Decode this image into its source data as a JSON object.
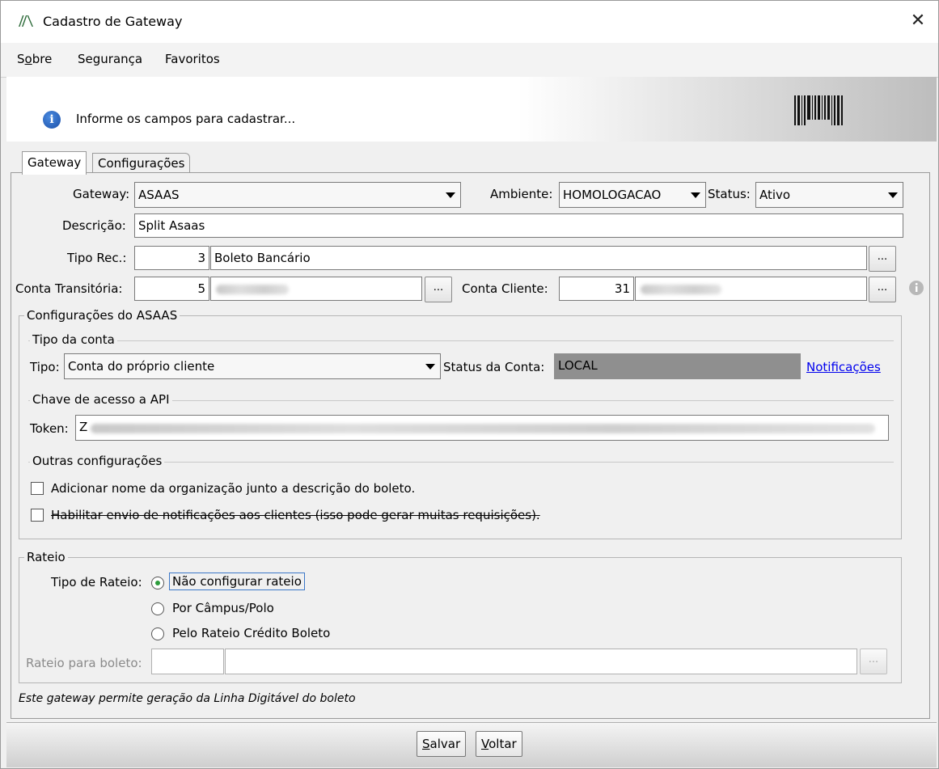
{
  "window": {
    "title": "Cadastro de Gateway",
    "close_glyph": "✕"
  },
  "menu": {
    "items": [
      "Sobre",
      "Segurança",
      "Favoritos"
    ]
  },
  "info": {
    "message": "Informe os campos para cadastrar..."
  },
  "tabs": [
    "Gateway",
    "Configurações"
  ],
  "form": {
    "gateway_label": "Gateway:",
    "gateway_value": "ASAAS",
    "ambiente_label": "Ambiente:",
    "ambiente_value": "HOMOLOGACAO",
    "status_label": "Status:",
    "status_value": "Ativo",
    "descricao_label": "Descrição:",
    "descricao_value": "Split Asaas",
    "tipo_rec_label": "Tipo Rec.:",
    "tipo_rec_code": "3",
    "tipo_rec_desc": "Boleto Bancário",
    "conta_transitoria_label": "Conta Transitória:",
    "conta_transitoria_code": "5",
    "conta_cliente_label": "Conta Cliente:",
    "conta_cliente_code": "31",
    "dots": "..."
  },
  "asaas": {
    "group_title": "Configurações do ASAAS",
    "tipo_conta_section": "Tipo da conta",
    "tipo_label": "Tipo:",
    "tipo_value": "Conta do próprio cliente",
    "status_conta_label": "Status da Conta:",
    "status_conta_value": "LOCAL",
    "notificacoes_link": "Notificações",
    "chave_section": "Chave de acesso a API",
    "token_label": "Token:",
    "token_prefix": "Z",
    "outras_section": "Outras configurações",
    "check1_label": "Adicionar nome da organização junto a descrição do boleto.",
    "check1_checked": false,
    "check2_label": "Habilitar envio de notificações aos clientes (isso pode gerar muitas requisições).",
    "check2_checked": false
  },
  "rateio": {
    "group_title": "Rateio",
    "tipo_label": "Tipo de Rateio:",
    "options": [
      "Não configurar rateio",
      "Por Câmpus/Polo",
      "Pelo Rateio Crédito Boleto"
    ],
    "selected_index": 0,
    "boleto_label": "Rateio para boleto:"
  },
  "footer_note": "Este gateway permite geração da Linha Digitável do boleto",
  "buttons": {
    "salvar": "Salvar",
    "voltar": "Voltar"
  },
  "colors": {
    "status_conta_bg": "#8f8f8f",
    "link": "#0000ee",
    "radio_dot": "#2d9c3c"
  }
}
